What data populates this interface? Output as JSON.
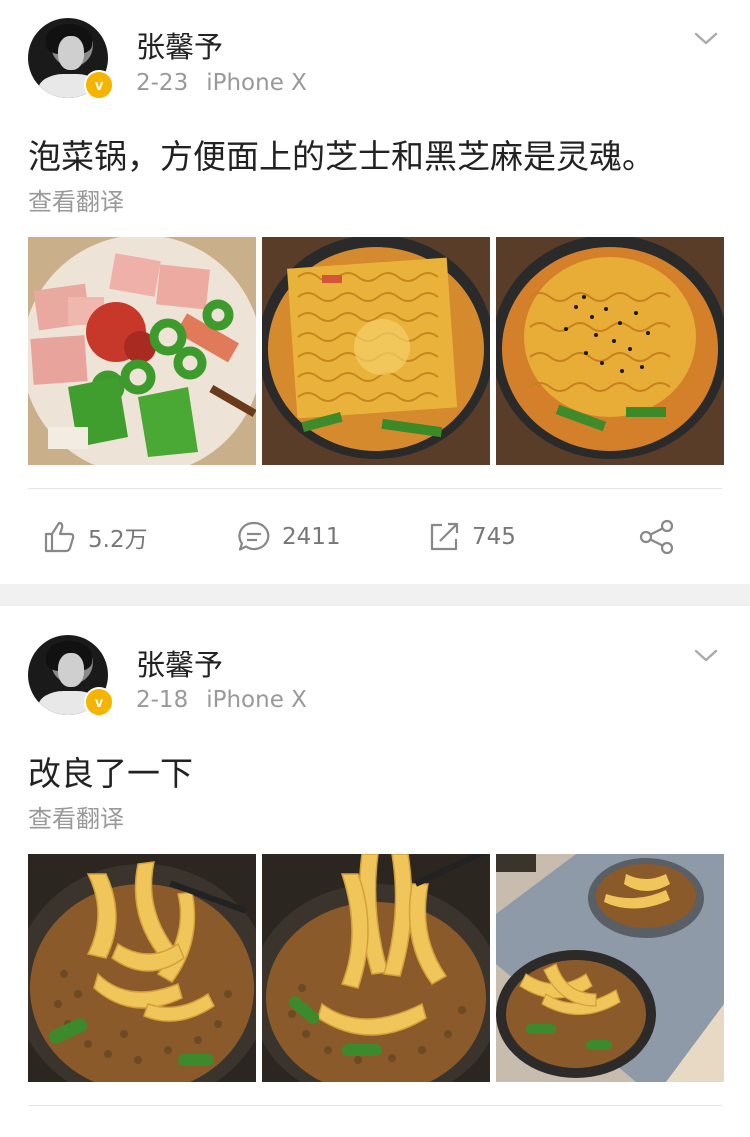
{
  "posts": [
    {
      "author": "张馨予",
      "date": "2-23",
      "device": "iPhone X",
      "text": "泡菜锅，方便面上的芝士和黑芝麻是灵魂。",
      "translate": "查看翻译",
      "likes": "5.2万",
      "comments": "2411",
      "reposts": "745"
    },
    {
      "author": "张馨予",
      "date": "2-18",
      "device": "iPhone X",
      "text": "改良了一下",
      "translate": "查看翻译"
    }
  ],
  "colors": {
    "verified_badge": "#f5b400",
    "meta_text": "#999999",
    "separator": "#f1f1f1"
  },
  "icons": [
    "chevron-down-icon",
    "like-icon",
    "comment-icon",
    "repost-icon",
    "share-icon",
    "verified-badge-icon"
  ]
}
